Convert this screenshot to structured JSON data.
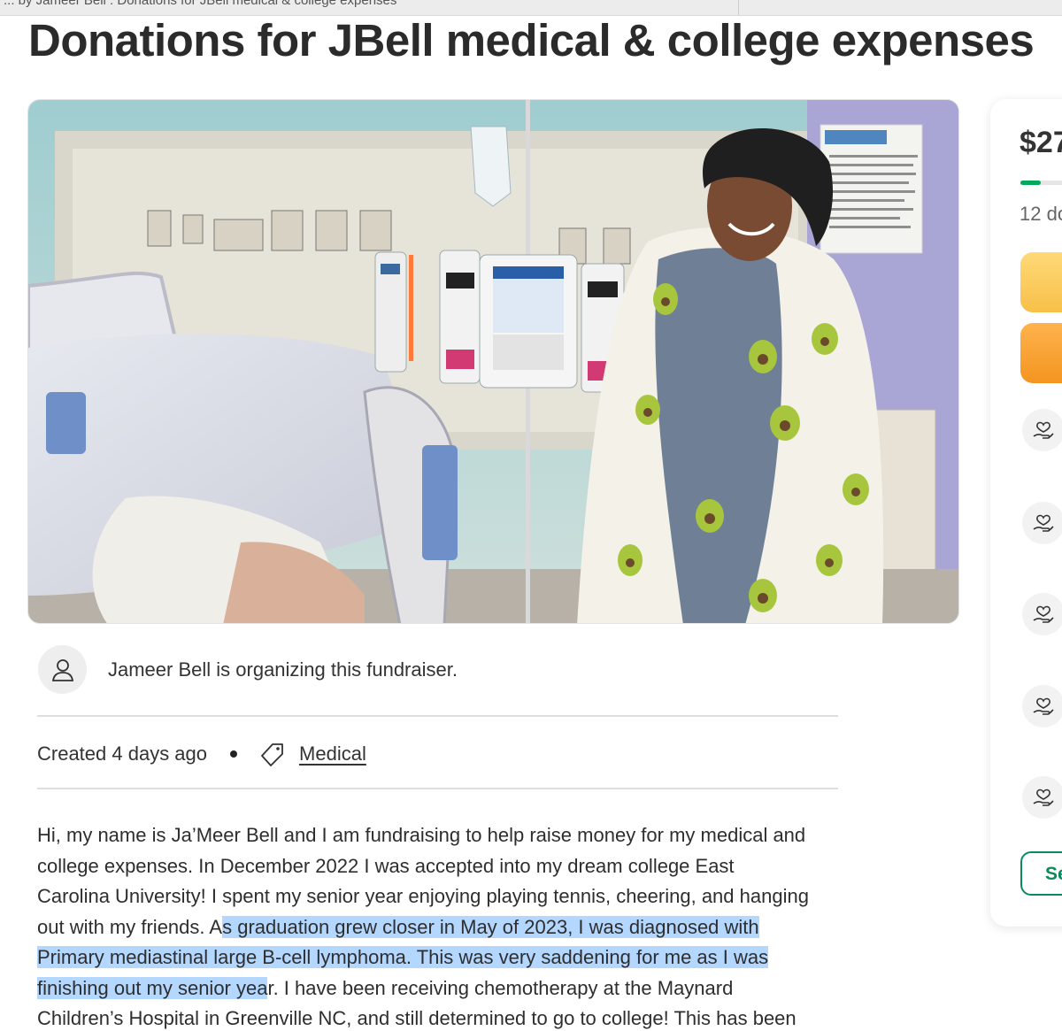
{
  "browser": {
    "tab_title": "... by Jameer Bell : Donations for JBell medical & college expenses"
  },
  "campaign": {
    "title": "Donations for JBell medical & college expenses",
    "organizer_text": "Jameer Bell is organizing this fundraiser.",
    "created": "Created 4 days ago",
    "category": "Medical"
  },
  "story": {
    "lines": [
      "Hi, my name is Ja’Meer Bell and I am fundraising to help raise money for my medical and",
      "college expenses. In December 2022 I was accepted into my dream college East",
      "Carolina University! I spent my senior year enjoying playing tennis, cheering, and hanging",
      "out with my friends. A",
      "s graduation grew closer in May of 2023, I was diagnosed with",
      "Primary mediastinal large B-cell lymphoma. This was very saddening for me as I was",
      "finishing out my senior yea",
      "r. I have been receiving chemotherapy at the Maynard",
      "Children’s Hospital in Greenville NC, and still determined to go to college! This has been"
    ]
  },
  "sidebar": {
    "amount_raised": "$27",
    "progress_fraction": 0.25,
    "donation_count": "12 do",
    "see_all_label": "Se"
  },
  "colors": {
    "accent_green": "#02a95c",
    "share_button": "#f7c048",
    "donate_button": "#f39521",
    "selection_highlight": "#b3d7ff",
    "see_all_green": "#0c8a5c"
  },
  "icons": {
    "organizer": "user-icon",
    "category": "tag-icon",
    "donor": "heart-hand-icon"
  }
}
